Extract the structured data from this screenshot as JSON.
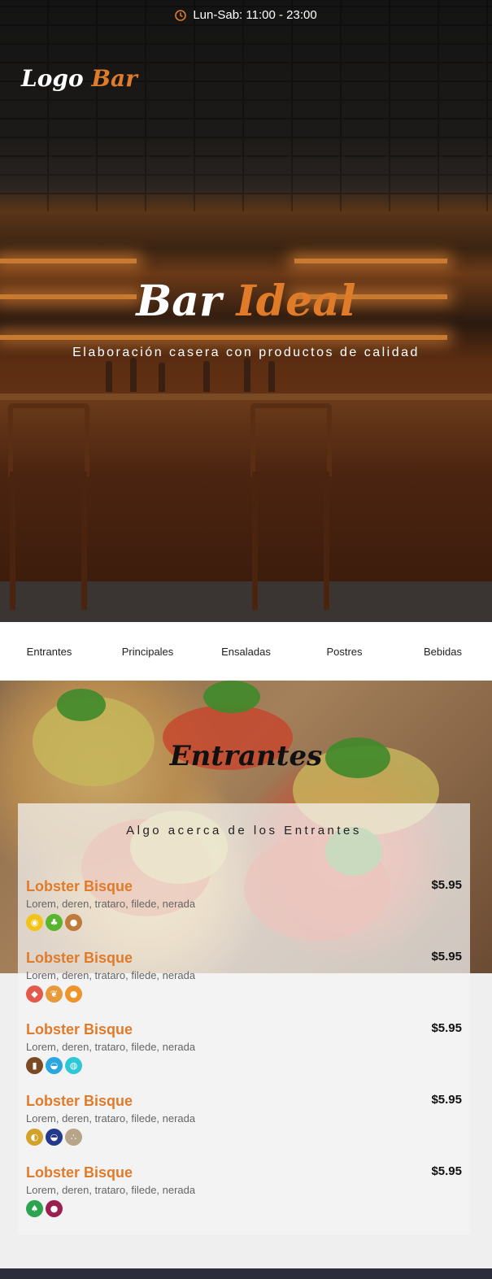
{
  "header": {
    "hours": "Lun-Sab: 11:00 - 23:00",
    "logo_main": "Logo",
    "logo_accent": "Bar"
  },
  "hero": {
    "title_main": "Bar",
    "title_accent": "Ideal",
    "subtitle": "Elaboración casera con productos de calidad"
  },
  "nav": {
    "tabs": [
      "Entrantes",
      "Principales",
      "Ensaladas",
      "Postres",
      "Bebidas"
    ]
  },
  "section": {
    "title": "Entrantes",
    "subtitle": "Algo acerca de los Entrantes"
  },
  "menu_items": [
    {
      "name": "Lobster Bisque",
      "price": "$5.95",
      "desc": "Lorem, deren, trataro, filede, nerada",
      "allergens": [
        {
          "icon": "egg-icon",
          "color": "#f2c418"
        },
        {
          "icon": "celery-icon",
          "color": "#5ab52e"
        },
        {
          "icon": "peanut-icon",
          "color": "#c07a3a"
        }
      ]
    },
    {
      "name": "Lobster Bisque",
      "price": "$5.95",
      "desc": "Lorem, deren, trataro, filede, nerada",
      "allergens": [
        {
          "icon": "crustacean-icon",
          "color": "#e35a4a"
        },
        {
          "icon": "gluten-icon",
          "color": "#e89a3a"
        },
        {
          "icon": "nuts-icon",
          "color": "#f0942a"
        }
      ]
    },
    {
      "name": "Lobster Bisque",
      "price": "$5.95",
      "desc": "Lorem, deren, trataro, filede, nerada",
      "allergens": [
        {
          "icon": "milk-icon",
          "color": "#7a4a22"
        },
        {
          "icon": "fish-icon",
          "color": "#2aa6e0"
        },
        {
          "icon": "mollusc-icon",
          "color": "#2ec7d6"
        }
      ]
    },
    {
      "name": "Lobster Bisque",
      "price": "$5.95",
      "desc": "Lorem, deren, trataro, filede, nerada",
      "allergens": [
        {
          "icon": "mustard-icon",
          "color": "#d2a22a"
        },
        {
          "icon": "fish-icon",
          "color": "#233a8a"
        },
        {
          "icon": "sesame-icon",
          "color": "#b8a488"
        }
      ]
    },
    {
      "name": "Lobster Bisque",
      "price": "$5.95",
      "desc": "Lorem, deren, trataro, filede, nerada",
      "allergens": [
        {
          "icon": "soy-icon",
          "color": "#2ca34e"
        },
        {
          "icon": "sulphite-icon",
          "color": "#9a2050"
        }
      ]
    }
  ]
}
